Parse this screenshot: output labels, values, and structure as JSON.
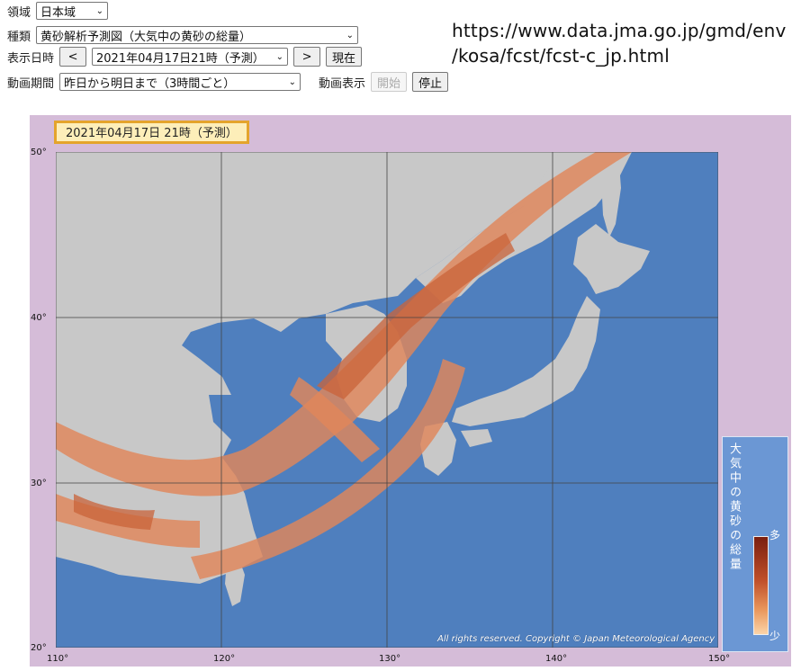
{
  "controls": {
    "region": {
      "label": "領域",
      "value": "日本域"
    },
    "type": {
      "label": "種類",
      "value": "黄砂解析予測図（大気中の黄砂の総量）"
    },
    "datetime": {
      "label": "表示日時",
      "prev": "<",
      "value": "2021年04月17日21時（予測）",
      "next": ">",
      "now": "現在"
    },
    "animation": {
      "label": "動画期間",
      "value": "昨日から明日まで（3時間ごと）",
      "display_label": "動画表示",
      "start": "開始",
      "stop": "停止"
    }
  },
  "url": {
    "line1": "https://www.data.jma.go.jp/gmd/env",
    "line2": "/kosa/fcst/fcst-c_jp.html"
  },
  "map": {
    "title": "2021年04月17日 21時（予測）",
    "lat_labels": [
      "50°",
      "40°",
      "30°",
      "20°"
    ],
    "lon_labels": [
      "110°",
      "120°",
      "130°",
      "140°",
      "150°"
    ],
    "copyright": "All rights reserved. Copyright © Japan Meteorological Agency",
    "legend": {
      "title": "大気中の黄砂の総量",
      "high": "多",
      "low": "少"
    },
    "colors": {
      "sea": "#4f7fbe",
      "land": "#c8c8c8",
      "dust": "#e0865a",
      "frame": "#d5bcd8"
    }
  }
}
